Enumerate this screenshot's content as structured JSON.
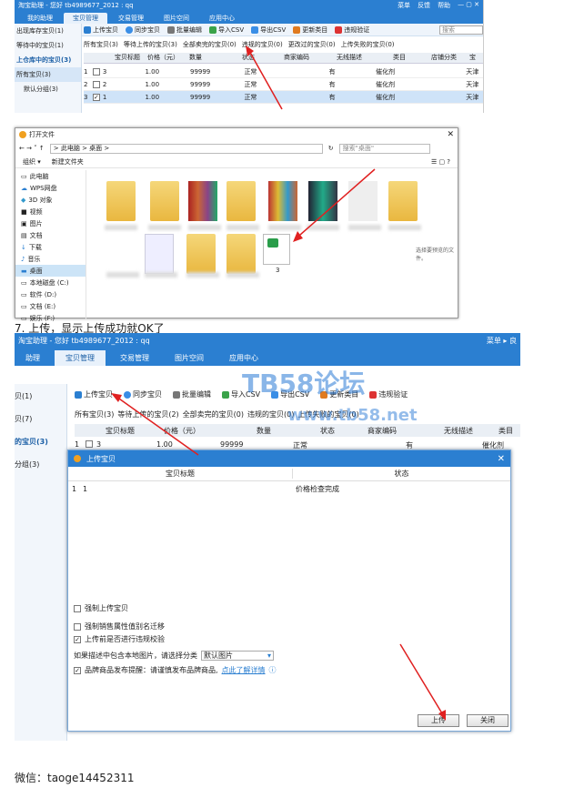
{
  "shot1": {
    "title": "淘宝助理 - 您好 tb4989677_2012 : qq",
    "title_right": [
      "菜单",
      "反馈",
      "帮助"
    ],
    "tabs": [
      "我的助理",
      "宝贝管理",
      "交易管理",
      "图片空间",
      "应用中心"
    ],
    "toolbar": [
      "上传宝贝",
      "同步宝贝",
      "批量编辑",
      "导入CSV",
      "导出CSV",
      "更新类目",
      "违规验证"
    ],
    "search_placeholder": "搜索",
    "sidebar": [
      "出现库存宝贝(1)",
      "等待中的宝贝(1)",
      "上仓库中的宝贝(3)",
      "所有宝贝(3)",
      "默认分组(3)"
    ],
    "filters": [
      "所有宝贝(3)",
      "等待上传的宝贝(3)",
      "全部卖完的宝贝(0)",
      "违规的宝贝(0)",
      "更改过的宝贝(0)",
      "上传失败的宝贝(0)"
    ],
    "columns": [
      "宝贝标题",
      "价格（元）",
      "数量",
      "状态",
      "商家编码",
      "无线描述",
      "类目",
      "店铺分类",
      "宝"
    ],
    "rows": [
      {
        "num": "1",
        "title": "3",
        "price": "1.00",
        "qty": "99999",
        "status": "正常",
        "wireless": "有",
        "cat": "催化剂",
        "ship": "天津"
      },
      {
        "num": "2",
        "title": "2",
        "price": "1.00",
        "qty": "99999",
        "status": "正常",
        "wireless": "有",
        "cat": "催化剂",
        "ship": "天津"
      },
      {
        "num": "3",
        "title": "1",
        "price": "1.00",
        "qty": "99999",
        "status": "正常",
        "wireless": "有",
        "cat": "催化剂",
        "ship": "天津"
      }
    ]
  },
  "dialog": {
    "title": "打开文件",
    "path": "> 此电脑 > 桌面 >",
    "search_placeholder": "搜索\"桌面\"",
    "organize": "组织 ▾",
    "new_folder": "新建文件夹",
    "sidebar": [
      "此电脑",
      "WPS网盘",
      "3D 对象",
      "视频",
      "图片",
      "文档",
      "下载",
      "音乐",
      "桌面",
      "本地磁盘 (C:)",
      "软件 (D:)",
      "文档 (E:)",
      "娱乐 (F:)"
    ],
    "file_label": "3",
    "preview_text": "选择要预览的文件。"
  },
  "step7": "7. 上传，显示上传成功就OK了",
  "shot2": {
    "title": "淘宝助理 - 您好 tb4989677_2012 : qq",
    "title_right": "菜单 ▸ 良",
    "tabs": [
      "助理",
      "宝贝管理",
      "交易管理",
      "图片空间",
      "应用中心"
    ],
    "toolbar": [
      "上传宝贝",
      "同步宝贝",
      "批量编辑",
      "导入CSV",
      "导出CSV",
      "更新类目",
      "违规验证"
    ],
    "sidebar": [
      "贝(1)",
      "贝(7)",
      "的宝贝(3)",
      "分组(3)"
    ],
    "filters": [
      "所有宝贝(3)",
      "等待上传的宝贝(2)",
      "全部卖完的宝贝(0)",
      "违规的宝贝(0)",
      "上传失败的宝贝(0)"
    ],
    "columns": [
      "宝贝标题",
      "价格（元）",
      "数量",
      "状态",
      "商家编码",
      "无线描述",
      "类目"
    ],
    "row": {
      "num": "1",
      "title": "3",
      "price": "1.00",
      "qty": "99999",
      "status": "正常",
      "wireless": "有",
      "cat": "催化剂"
    },
    "watermark": "TB58论坛",
    "watermark_url": "www.tb58.net"
  },
  "modal": {
    "title": "上传宝贝",
    "col_title": "宝贝标题",
    "col_status": "状态",
    "row_num": "1",
    "row_title": "1",
    "row_status": "价格检查完成",
    "opt1": "强制上传宝贝",
    "opt2": "强制销售属性值别名迁移",
    "opt3": "上传前是否进行违规校验",
    "category_label": "如果描述中包含本地图片，请选择分类",
    "category_value": "默认图片",
    "brand_text": "品牌商品发布提醒：请谨慎发布品牌商品,",
    "brand_link": "点此了解详情",
    "upload_btn": "上传",
    "close_btn": "关闭"
  },
  "wechat": "微信：taoge14452311"
}
